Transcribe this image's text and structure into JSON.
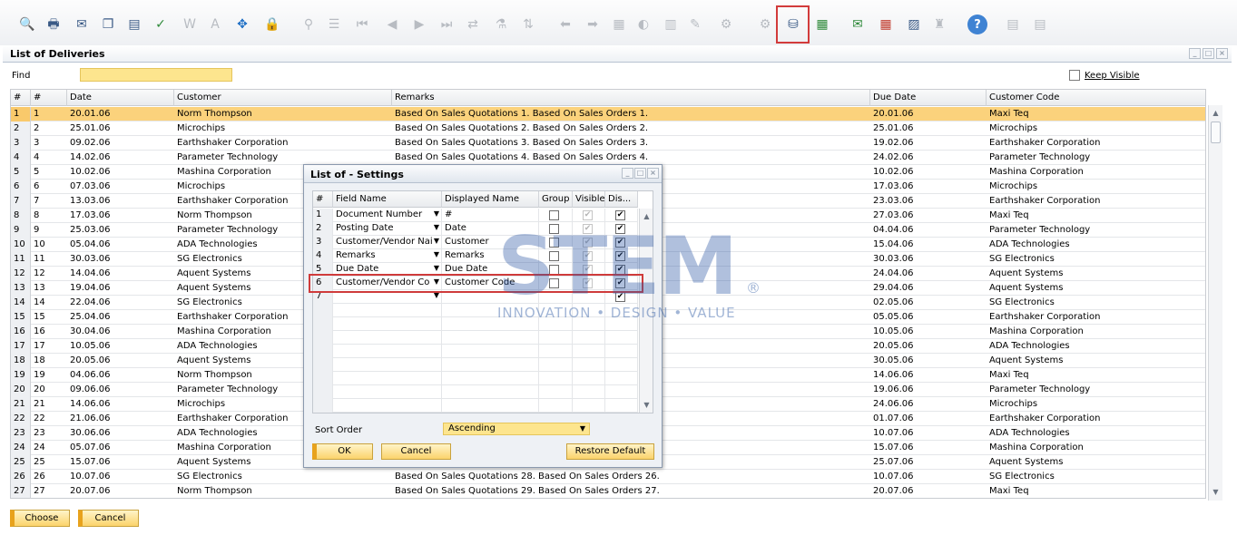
{
  "toolbar": {
    "icons": [
      "search-icon",
      "print-icon",
      "email-icon",
      "copy-icon",
      "fax-icon",
      "excel-icon",
      "word-icon",
      "pdf-icon",
      "navigate-icon",
      "lock-icon",
      "find-icon",
      "list-icon",
      "first-record-icon",
      "previous-record-icon",
      "next-record-icon",
      "last-record-icon",
      "refresh-icon",
      "filter-icon",
      "sort-icon",
      "base-document-icon",
      "target-document-icon",
      "journal-icon",
      "payment-icon",
      "gross-profit-icon",
      "layout-designer-icon",
      "preview-icon",
      "form-settings-icon",
      "settings-icon",
      "database-icon",
      "calendar-icon",
      "message-icon",
      "calculator-icon",
      "org-chart-icon",
      "help-icon",
      "lock-screen-icon",
      "data-icon"
    ],
    "help_label": "?"
  },
  "window": {
    "title": "List of Deliveries",
    "find_label": "Find",
    "find_value": "",
    "keep_visible_label": "Keep Visible"
  },
  "grid": {
    "headers": [
      "#",
      "#",
      "Date",
      "Customer",
      "Remarks",
      "Due Date",
      "Customer Code"
    ],
    "rows": [
      [
        "1",
        "1",
        "20.01.06",
        "Norm Thompson",
        "Based On Sales Quotations 1. Based On Sales Orders 1.",
        "20.01.06",
        "Maxi Teq"
      ],
      [
        "2",
        "2",
        "25.01.06",
        "Microchips",
        "Based On Sales Quotations 2. Based On Sales Orders 2.",
        "25.01.06",
        "Microchips"
      ],
      [
        "3",
        "3",
        "09.02.06",
        "Earthshaker Corporation",
        "Based On Sales Quotations 3. Based On Sales Orders 3.",
        "19.02.06",
        "Earthshaker Corporation"
      ],
      [
        "4",
        "4",
        "14.02.06",
        "Parameter Technology",
        "Based On Sales Quotations 4. Based On Sales Orders 4.",
        "24.02.06",
        "Parameter Technology"
      ],
      [
        "5",
        "5",
        "10.02.06",
        "Mashina Corporation",
        "",
        "10.02.06",
        "Mashina Corporation"
      ],
      [
        "6",
        "6",
        "07.03.06",
        "Microchips",
        "",
        "17.03.06",
        "Microchips"
      ],
      [
        "7",
        "7",
        "13.03.06",
        "Earthshaker Corporation",
        "",
        "23.03.06",
        "Earthshaker Corporation"
      ],
      [
        "8",
        "8",
        "17.03.06",
        "Norm Thompson",
        "",
        "27.03.06",
        "Maxi Teq"
      ],
      [
        "9",
        "9",
        "25.03.06",
        "Parameter Technology",
        "",
        "04.04.06",
        "Parameter Technology"
      ],
      [
        "10",
        "10",
        "05.04.06",
        "ADA Technologies",
        "",
        "15.04.06",
        "ADA Technologies"
      ],
      [
        "11",
        "11",
        "30.03.06",
        "SG Electronics",
        "",
        "30.03.06",
        "SG Electronics"
      ],
      [
        "12",
        "12",
        "14.04.06",
        "Aquent Systems",
        "",
        "24.04.06",
        "Aquent Systems"
      ],
      [
        "13",
        "13",
        "19.04.06",
        "Aquent Systems",
        "",
        "29.04.06",
        "Aquent Systems"
      ],
      [
        "14",
        "14",
        "22.04.06",
        "SG Electronics",
        "",
        "02.05.06",
        "SG Electronics"
      ],
      [
        "15",
        "15",
        "25.04.06",
        "Earthshaker Corporation",
        "",
        "05.05.06",
        "Earthshaker Corporation"
      ],
      [
        "16",
        "16",
        "30.04.06",
        "Mashina Corporation",
        "",
        "10.05.06",
        "Mashina Corporation"
      ],
      [
        "17",
        "17",
        "10.05.06",
        "ADA Technologies",
        "",
        "20.05.06",
        "ADA Technologies"
      ],
      [
        "18",
        "18",
        "20.05.06",
        "Aquent Systems",
        "",
        "30.05.06",
        "Aquent Systems"
      ],
      [
        "19",
        "19",
        "04.06.06",
        "Norm Thompson",
        "",
        "14.06.06",
        "Maxi Teq"
      ],
      [
        "20",
        "20",
        "09.06.06",
        "Parameter Technology",
        "",
        "19.06.06",
        "Parameter Technology"
      ],
      [
        "21",
        "21",
        "14.06.06",
        "Microchips",
        "",
        "24.06.06",
        "Microchips"
      ],
      [
        "22",
        "22",
        "21.06.06",
        "Earthshaker Corporation",
        "",
        "01.07.06",
        "Earthshaker Corporation"
      ],
      [
        "23",
        "23",
        "30.06.06",
        "ADA Technologies",
        "",
        "10.07.06",
        "ADA Technologies"
      ],
      [
        "24",
        "24",
        "05.07.06",
        "Mashina Corporation",
        "",
        "15.07.06",
        "Mashina Corporation"
      ],
      [
        "25",
        "25",
        "15.07.06",
        "Aquent Systems",
        "",
        "25.07.06",
        "Aquent Systems"
      ],
      [
        "26",
        "26",
        "10.07.06",
        "SG Electronics",
        "Based On Sales Quotations 28. Based On Sales Orders 26.",
        "10.07.06",
        "SG Electronics"
      ],
      [
        "27",
        "27",
        "20.07.06",
        "Norm Thompson",
        "Based On Sales Quotations 29. Based On Sales Orders 27.",
        "20.07.06",
        "Maxi Teq"
      ]
    ]
  },
  "buttons": {
    "choose": "Choose",
    "cancel": "Cancel"
  },
  "dialog": {
    "title": "List of - Settings",
    "headers": [
      "#",
      "Field Name",
      "Displayed Name",
      "Group",
      "Visible",
      "Dis..."
    ],
    "rows": [
      {
        "num": "1",
        "field": "Document Number",
        "display": "#",
        "group": false,
        "visible": true,
        "dis": true
      },
      {
        "num": "2",
        "field": "Posting Date",
        "display": "Date",
        "group": false,
        "visible": true,
        "dis": true
      },
      {
        "num": "3",
        "field": "Customer/Vendor Nai",
        "display": "Customer",
        "group": false,
        "visible": true,
        "dis": true
      },
      {
        "num": "4",
        "field": "Remarks",
        "display": "Remarks",
        "group": false,
        "visible": true,
        "dis": true
      },
      {
        "num": "5",
        "field": "Due Date",
        "display": "Due Date",
        "group": false,
        "visible": true,
        "dis": true
      },
      {
        "num": "6",
        "field": "Customer/Vendor Co",
        "display": "Customer Code",
        "group": false,
        "visible": true,
        "dis": true
      },
      {
        "num": "7",
        "field": "",
        "display": "",
        "group": false,
        "visible": false,
        "dis": true
      }
    ],
    "sort_label": "Sort Order",
    "sort_value": "Ascending",
    "ok": "OK",
    "cancel": "Cancel",
    "restore": "Restore Default"
  },
  "watermark": {
    "brand": "STEM",
    "tagline": "INNOVATION • DESIGN • VALUE",
    "reg": "®"
  },
  "colors": {
    "selected_row": "#fbd27c",
    "input_yellow": "#fde58e",
    "highlight_red": "#d23b3b"
  }
}
